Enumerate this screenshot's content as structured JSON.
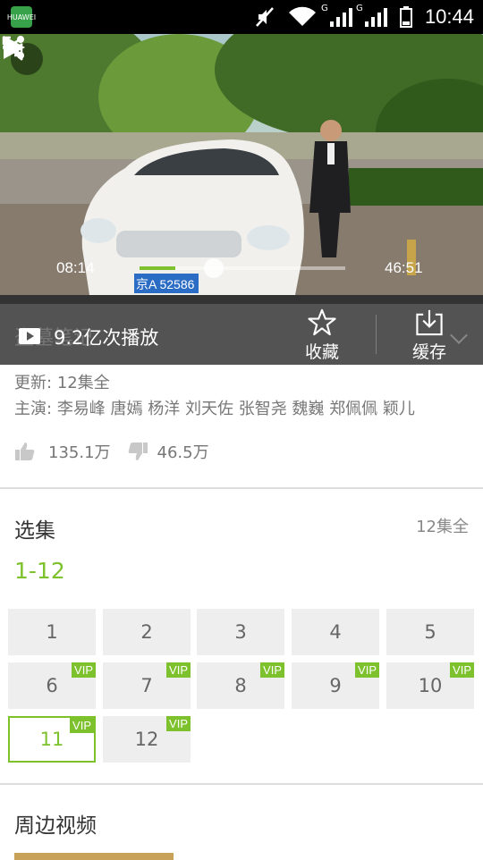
{
  "status_bar": {
    "time": "10:44",
    "app_badge": "HUAWEI",
    "net1": "G",
    "net2": "G"
  },
  "player": {
    "current_time": "08:14",
    "duration": "46:51",
    "progress": 0.176,
    "plate_text": "京A 52586",
    "colors": {
      "accent": "#7dc12d"
    }
  },
  "action_bar": {
    "ghost_title": "盗墓笔记",
    "views": "9.2亿次播放",
    "favorite_label": "收藏",
    "cache_label": "缓存"
  },
  "meta": {
    "update_label": "更新:",
    "update_value": "12集全",
    "cast_label": "主演:",
    "cast": "李易峰 唐嫣 杨洋 刘天佐 张智尧 魏巍 郑佩佩 颖儿"
  },
  "reactions": {
    "likes": "135.1万",
    "dislikes": "46.5万"
  },
  "episodes_section": {
    "title": "选集",
    "total": "12集全",
    "range": "1-12",
    "vip_label": "VIP",
    "episodes": [
      {
        "num": "1",
        "vip": false
      },
      {
        "num": "2",
        "vip": false
      },
      {
        "num": "3",
        "vip": false
      },
      {
        "num": "4",
        "vip": false
      },
      {
        "num": "5",
        "vip": false
      },
      {
        "num": "6",
        "vip": true
      },
      {
        "num": "7",
        "vip": true
      },
      {
        "num": "8",
        "vip": true
      },
      {
        "num": "9",
        "vip": true
      },
      {
        "num": "10",
        "vip": true
      },
      {
        "num": "11",
        "vip": true,
        "selected": true
      },
      {
        "num": "12",
        "vip": true
      }
    ]
  },
  "related": {
    "title": "周边视频"
  }
}
